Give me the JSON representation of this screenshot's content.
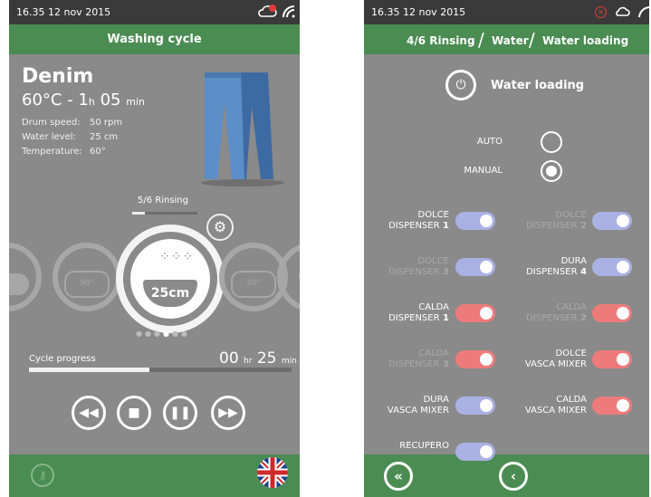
{
  "left": {
    "status": {
      "time_date": "16.35  12 nov 2015",
      "cloud_icon": "cloud-alert-icon",
      "wifi_icon": "wifi-icon"
    },
    "title": "Washing cycle",
    "program": {
      "name": "Denim",
      "temp": "60°C - 1",
      "hour_unit": "h",
      "minutes": "05",
      "min_unit": "min",
      "params": [
        {
          "label": "Drum speed:",
          "value": "50 rpm"
        },
        {
          "label": "Water level:",
          "value": "25 cm"
        },
        {
          "label": "Temperature:",
          "value": "60°"
        }
      ]
    },
    "phase": {
      "label": "5/6 Rinsing",
      "progress": 0.2
    },
    "drums": {
      "current_value": "25cm",
      "prev_label": "90°",
      "next_label": "30°",
      "page_count": 6,
      "active_page": 4
    },
    "progress": {
      "label": "Cycle progress",
      "hours": "00",
      "hour_unit": "hr",
      "minutes": "25",
      "min_unit": "min",
      "fraction": 0.46
    },
    "controls": [
      "rewind",
      "stop",
      "pause",
      "fast-forward"
    ],
    "bottom": {
      "key_icon": "key-icon",
      "language": "en-GB"
    }
  },
  "right": {
    "status": {
      "time_date": "16.35  12 nov 2015"
    },
    "breadcrumb": [
      "4/6 Rinsing",
      "Water",
      "Water loading"
    ],
    "section_title": "Water loading",
    "modes": [
      {
        "label": "AUTO",
        "selected": false
      },
      {
        "label": "MANUAL",
        "selected": true
      }
    ],
    "dispensers": [
      {
        "line1": "DOLCE",
        "line2": "DISPENSER",
        "num": "1",
        "color": "#aab1e3",
        "enabled": true,
        "col": 0
      },
      {
        "line1": "DOLCE",
        "line2": "DISPENSER",
        "num": "2",
        "color": "#aab1e3",
        "enabled": false,
        "col": 1
      },
      {
        "line1": "DOLCE",
        "line2": "DISPENSER",
        "num": "3",
        "color": "#aab1e3",
        "enabled": false,
        "col": 0
      },
      {
        "line1": "DURA",
        "line2": "DISPENSER",
        "num": "4",
        "color": "#aab1e3",
        "enabled": true,
        "col": 1
      },
      {
        "line1": "CALDA",
        "line2": "DISPENSER",
        "num": "1",
        "color": "#ee7b7b",
        "enabled": true,
        "col": 0
      },
      {
        "line1": "CALDA",
        "line2": "DISPENSER",
        "num": "2",
        "color": "#ee7b7b",
        "enabled": false,
        "col": 1
      },
      {
        "line1": "CALDA",
        "line2": "DISPENSER",
        "num": "3",
        "color": "#ee7b7b",
        "enabled": false,
        "col": 0
      },
      {
        "line1": "DOLCE",
        "line2": "VASCA MIXER",
        "num": "",
        "color": "#ee7b7b",
        "enabled": true,
        "col": 1
      },
      {
        "line1": "DURA",
        "line2": "VASCA MIXER",
        "num": "",
        "color": "#aab1e3",
        "enabled": true,
        "col": 0
      },
      {
        "line1": "CALDA",
        "line2": "VASCA MIXER",
        "num": "",
        "color": "#ee7b7b",
        "enabled": true,
        "col": 1
      },
      {
        "line1": "RECUPERO",
        "line2": "",
        "num": "",
        "color": "#aab1e3",
        "enabled": true,
        "col": 0
      }
    ],
    "nav": [
      "double-chevron-left",
      "chevron-left"
    ]
  }
}
